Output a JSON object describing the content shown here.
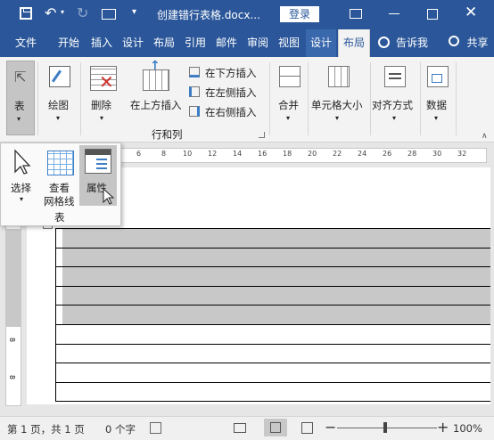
{
  "titlebar": {
    "document_title": "创建错行表格.docx...",
    "login_label": "登录"
  },
  "tabs": [
    {
      "label": "文件"
    },
    {
      "label": "开始"
    },
    {
      "label": "插入"
    },
    {
      "label": "设计"
    },
    {
      "label": "布局"
    },
    {
      "label": "引用"
    },
    {
      "label": "邮件"
    },
    {
      "label": "审阅"
    },
    {
      "label": "视图"
    },
    {
      "label": "设计"
    },
    {
      "label": "布局"
    }
  ],
  "tell_me": {
    "label": "告诉我"
  },
  "share": {
    "label": "共享"
  },
  "ribbon": {
    "table_label": "表",
    "draw_label": "绘图",
    "delete_label": "删除",
    "insert_above_label": "在上方插入",
    "insert_below_label": "在下方插入",
    "insert_left_label": "在左侧插入",
    "insert_right_label": "在右侧插入",
    "group_rows_cols": "行和列",
    "merge_label": "合并",
    "cell_size_label": "单元格大小",
    "align_label": "对齐方式",
    "data_label": "数据"
  },
  "dropdown": {
    "select_label": "选择",
    "gridlines_label_1": "查看",
    "gridlines_label_2": "网格线",
    "properties_label": "属性",
    "group_label": "表"
  },
  "ruler": {
    "ticks": [
      "6",
      "8",
      "10",
      "12",
      "14",
      "16",
      "18",
      "20",
      "22",
      "24",
      "26",
      "28",
      "30",
      "32"
    ]
  },
  "vruler": {
    "marks": [
      "8",
      "8"
    ]
  },
  "statusbar": {
    "page_info": "第 1 页，共 1 页",
    "word_count": "0 个字",
    "zoom": "100%"
  },
  "colors": {
    "accent": "#2b579a",
    "ribbon": "#f3f3f3",
    "selection": "#c8c8c8"
  }
}
